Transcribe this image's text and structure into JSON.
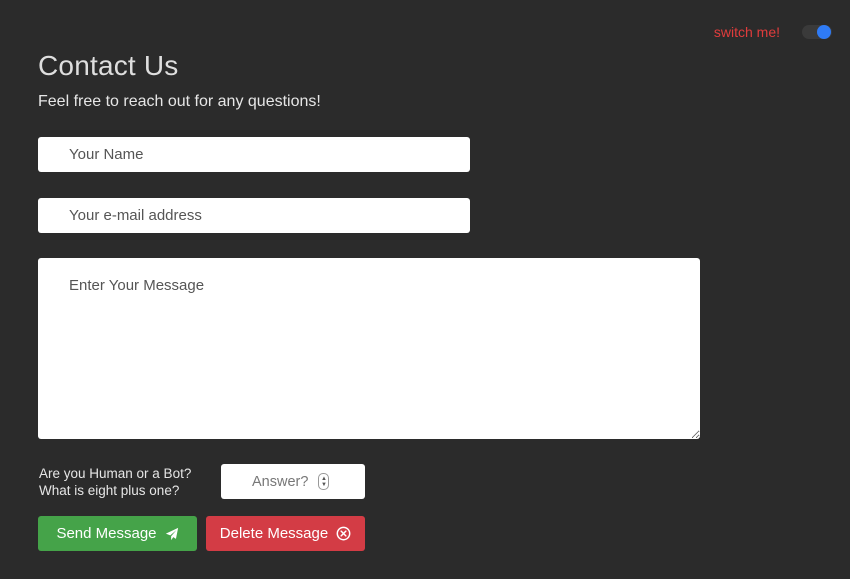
{
  "header": {
    "switch_label": "switch me!",
    "toggle_on": true,
    "title": "Contact Us",
    "subtitle": "Feel free to reach out for any questions!"
  },
  "form": {
    "name_placeholder": "Your Name",
    "name_value": "",
    "email_placeholder": "Your e-mail address",
    "email_value": "",
    "message_placeholder": "Enter Your Message",
    "message_value": "",
    "captcha_line1": "Are you Human or a Bot?",
    "captcha_line2": "What is eight plus one?",
    "answer_placeholder": "Answer?"
  },
  "buttons": {
    "send_label": "Send Message",
    "send_icon": "paper-plane-icon",
    "delete_label": "Delete Message",
    "delete_icon": "circle-x-icon"
  },
  "colors": {
    "background": "#2b2b2b",
    "switch_label": "#e03c3c",
    "toggle_knob": "#2f7bf5",
    "send_button": "#45a349",
    "delete_button": "#d33c45"
  }
}
